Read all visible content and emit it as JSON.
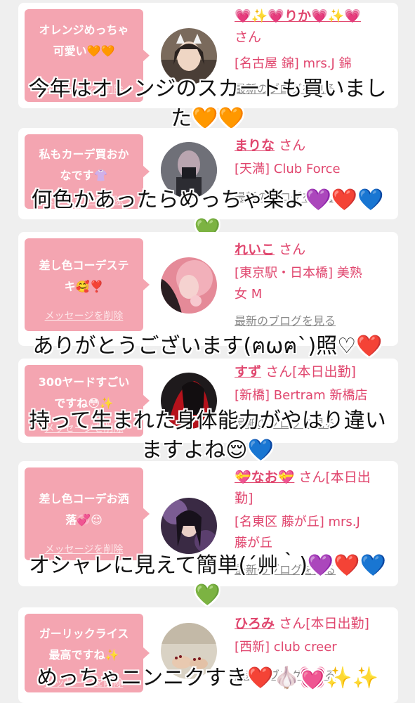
{
  "colors": {
    "bubble": "#f4a5b1",
    "accent": "#e0466e",
    "link_gray": "#8a8a8a"
  },
  "cards": [
    {
      "message": "オレンジめっちゃ\n可愛い🧡🧡",
      "delete_label": "メッセージを削除",
      "name": "💗✨💗りか💗✨💗",
      "honorific": "さん",
      "shop": "[名古屋 錦] mrs.J 錦",
      "blog_label": "最新のブログを見る",
      "caption": "今年はオレンジのスカートも買いまし\nた🧡🧡"
    },
    {
      "message": "私もカーデ買おか\nなです👚",
      "delete_label": "メッセージを削除",
      "name": "まりな",
      "honorific": "さん",
      "shop": "[天満] Club Force",
      "blog_label": "最新のブログを見る",
      "caption": "何色かあったらめっちゃ楽よ💜❤️💙\n💚"
    },
    {
      "message": "差し色コーデステ\nキ🥰❣️",
      "delete_label": "メッセージを削除",
      "name": "れいこ",
      "honorific": "さん",
      "shop": "[東京駅・日本橋] 美熟\n女 M",
      "blog_label": "最新のブログを見る",
      "caption": "ありがとうございます(ฅωฅ`)照♡❤️"
    },
    {
      "message": "300ヤードすごい\nですね😳✨",
      "delete_label": "メッセージを削除",
      "name": "すず",
      "honorific": "さん[本日出勤]",
      "shop": "[新橋] Bertram 新橋店",
      "blog_label": "最新のブログを見る",
      "caption": "持って生まれた身体能力がやはり違い\nますよね😌💙"
    },
    {
      "message": "差し色コーデお洒\n落💞😌",
      "delete_label": "メッセージを削除",
      "name": "💝なお💝",
      "honorific": "さん[本日出\n勤]",
      "shop": "[名東区 藤が丘] mrs.J\n藤が丘",
      "blog_label": "最新のブログを見る",
      "caption": "オシャレに見えて簡単(´艸｀)💜❤️💙\n💚"
    },
    {
      "message": "ガーリックライス\n最高ですね✨",
      "delete_label": "メッセージを削除",
      "name": "ひろみ",
      "honorific": "さん[本日出勤]",
      "shop": "[西新] club creer",
      "blog_label": "最新のブログを見る",
      "caption": "めっちゃニンニクすき❤️🧄💓✨✨"
    }
  ]
}
